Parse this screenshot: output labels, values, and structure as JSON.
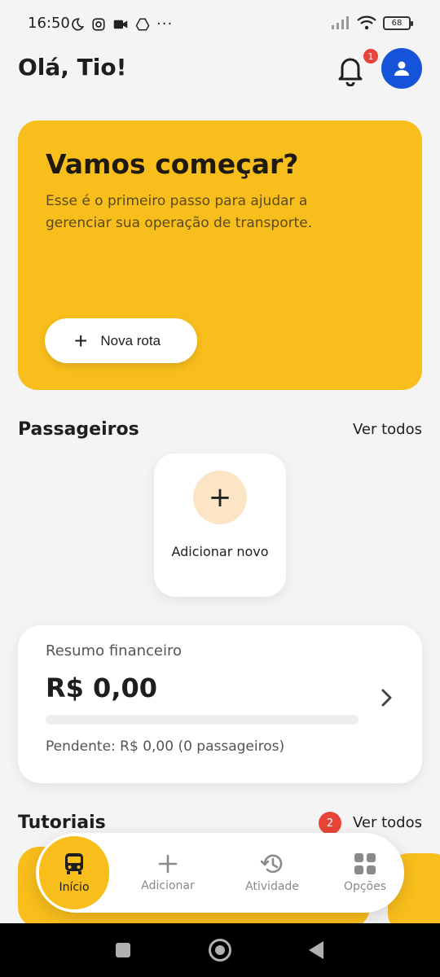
{
  "status_bar": {
    "time": "16:50",
    "battery": "68",
    "icons_left": [
      "moon-icon",
      "instagram-icon",
      "video-icon",
      "drive-icon",
      "more-dots-icon"
    ],
    "icons_right": [
      "signal-icon",
      "wifi-icon",
      "battery-icon"
    ]
  },
  "header": {
    "greeting": "Olá, Tio!",
    "notification_count": "1"
  },
  "hero": {
    "title": "Vamos começar?",
    "subtitle": "Esse é o primeiro passo para ajudar a gerenciar sua operação de transporte.",
    "button_label": "Nova rota"
  },
  "passengers": {
    "title": "Passageiros",
    "see_all": "Ver todos",
    "add_label": "Adicionar novo"
  },
  "finance": {
    "label": "Resumo financeiro",
    "value": "R$ 0,00",
    "progress": 0,
    "pending": "Pendente: R$ 0,00 (0 passageiros)"
  },
  "tutorials": {
    "title": "Tutoriais",
    "badge": "2",
    "see_all": "Ver todos"
  },
  "bottom_nav": {
    "items": [
      {
        "label": "Início",
        "icon": "bus-icon",
        "active": true
      },
      {
        "label": "Adicionar",
        "icon": "plus-icon",
        "active": false
      },
      {
        "label": "Atividade",
        "icon": "history-icon",
        "active": false
      },
      {
        "label": "Opções",
        "icon": "grid-icon",
        "active": false
      }
    ]
  },
  "colors": {
    "accent_yellow": "#f8be1c",
    "avatar_blue": "#1553d8",
    "badge_red": "#e8443a",
    "background": "#f4f4f4"
  }
}
